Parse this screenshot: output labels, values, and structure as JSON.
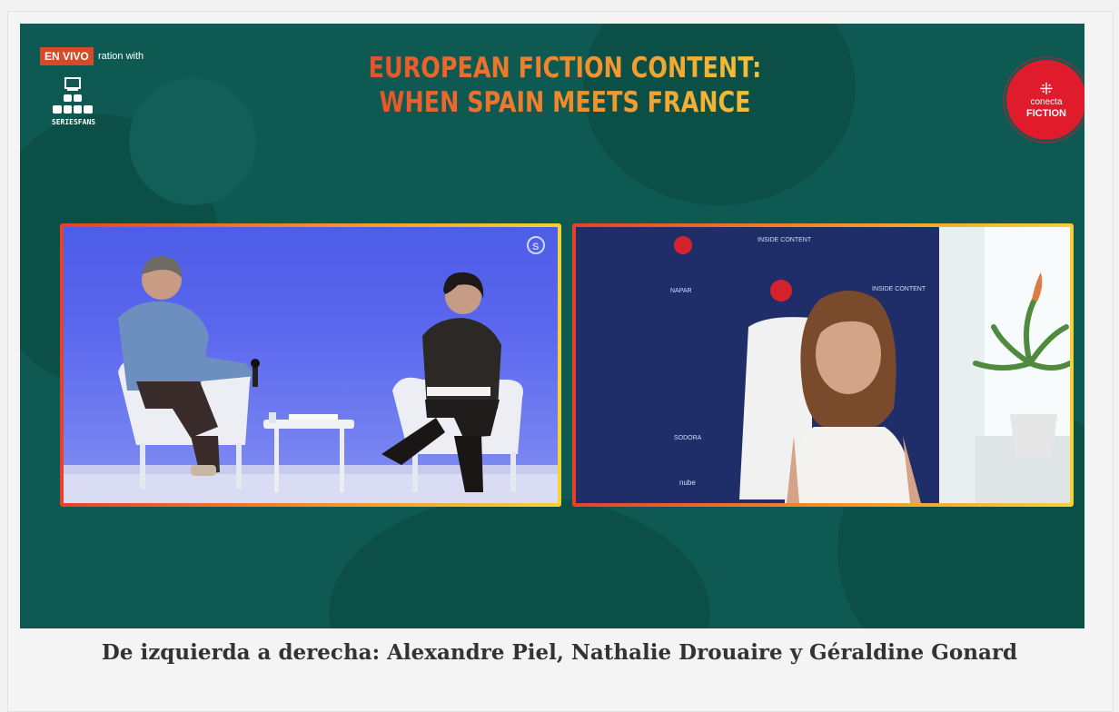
{
  "stream": {
    "live_badge": "EN VIVO",
    "collab_text": "ration with",
    "partner_logo_label": "SERIESFANS",
    "title_line1": "EUROPEAN FICTION CONTENT:",
    "title_line2": "WHEN SPAIN MEETS FRANCE",
    "event_logo": {
      "small": "conecta",
      "big": "FICTION",
      "color": "#e01c2c"
    },
    "left_video": {
      "description_icon": "skype-icon"
    },
    "right_video": {
      "backdrop_words": [
        "INSIDE CONTENT",
        "NAPAR",
        "INSIDE CONTENT",
        "SODORA",
        "nube"
      ]
    },
    "background_color": "#0e5a52"
  },
  "caption": "De izquierda a derecha: Alexandre Piel, Nathalie Drouaire y Géraldine Gonard"
}
